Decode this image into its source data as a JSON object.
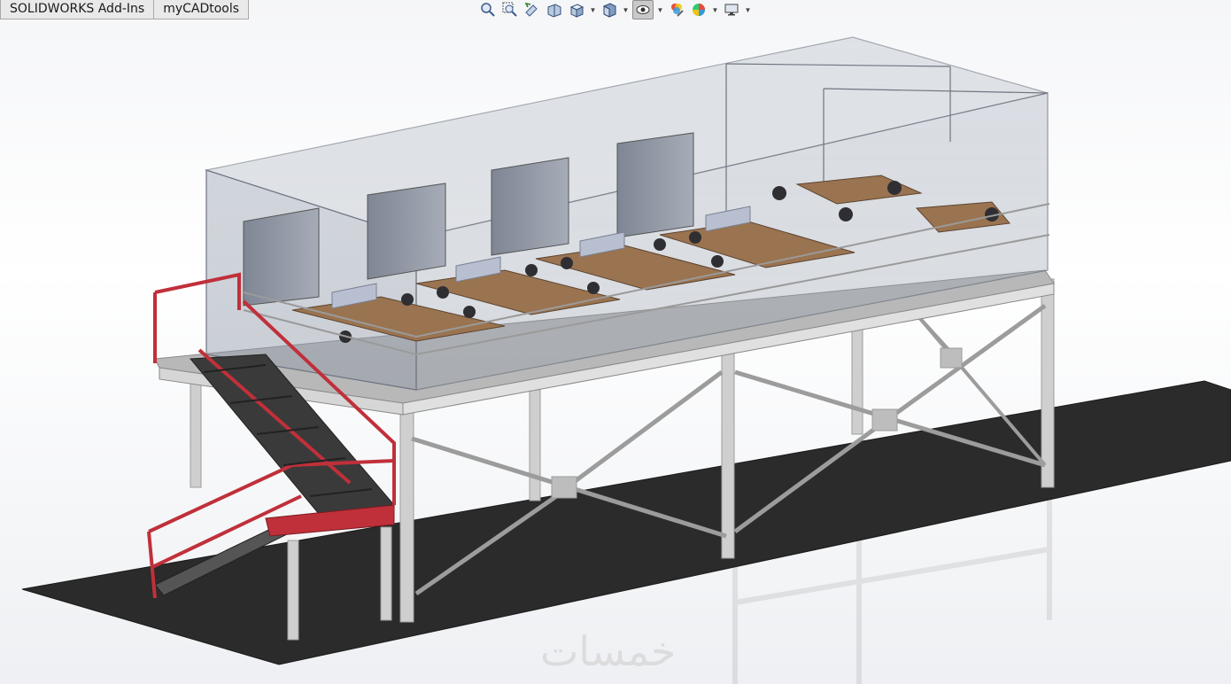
{
  "tabs": [
    {
      "label": "SOLIDWORKS Add-Ins"
    },
    {
      "label": "myCADtools"
    }
  ],
  "heads_up_toolbar": {
    "buttons": [
      {
        "icon": "zoom-to-fit-icon"
      },
      {
        "icon": "zoom-to-area-icon"
      },
      {
        "icon": "previous-view-icon"
      },
      {
        "icon": "section-view-icon"
      },
      {
        "icon": "view-orientation-icon",
        "has_menu": true
      },
      {
        "icon": "display-style-icon",
        "has_menu": true
      },
      {
        "icon": "hide-show-items-icon",
        "has_menu": true,
        "active": true
      },
      {
        "icon": "edit-appearance-icon"
      },
      {
        "icon": "apply-scene-icon",
        "has_menu": true
      },
      {
        "icon": "view-settings-icon",
        "has_menu": true
      }
    ]
  },
  "model": {
    "description_colors": {
      "floor_plate": "#2b2b2b",
      "steel_structure": "#c8c8c8",
      "stair_railing": "#c0303a",
      "glass_enclosure": "#9aa3b0",
      "desk_top": "#9a7350",
      "cabinet": "#8f96a3"
    }
  },
  "watermark": {
    "text": "خمسات"
  }
}
